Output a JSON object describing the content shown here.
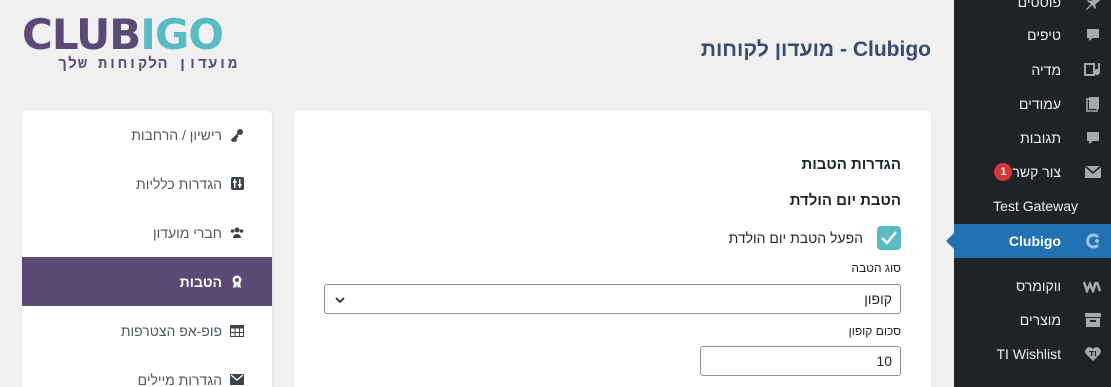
{
  "header": {
    "page_title": "Clubigo - מועדון לקוחות",
    "logo_part1": "CLUB",
    "logo_part2": "IGO",
    "logo_tagline": "מועדון הלקוחות שלך"
  },
  "wp_menu": {
    "items": [
      {
        "label": "פוסטים",
        "icon": "pin-icon"
      },
      {
        "label": "טיפים",
        "icon": "comment-icon"
      },
      {
        "label": "מדיה",
        "icon": "media-icon"
      },
      {
        "label": "עמודים",
        "icon": "pages-icon"
      },
      {
        "label": "תגובות",
        "icon": "comment-icon"
      },
      {
        "label": "צור קשר",
        "icon": "mail-icon",
        "badge": "1"
      },
      {
        "label": "Test Gateway"
      },
      {
        "label": "Clubigo",
        "icon": "clubigo-icon"
      },
      {
        "label": "ווקומרס",
        "icon": "woocommerce-icon"
      },
      {
        "label": "מוצרים",
        "icon": "archive-icon"
      },
      {
        "label": "TI Wishlist",
        "icon": "heart-icon"
      }
    ],
    "active_color": "#2271b1"
  },
  "settings_nav": {
    "items": [
      {
        "label": "רישיון / הרחבות",
        "icon": "key-icon"
      },
      {
        "label": "הגדרות כלליות",
        "icon": "settings-sliders-icon"
      },
      {
        "label": "חברי מועדון",
        "icon": "users-icon"
      },
      {
        "label": "הטבות",
        "icon": "award-icon",
        "active": true
      },
      {
        "label": "פופ-אפ הצטרפות",
        "icon": "table-icon"
      },
      {
        "label": "הגדרות מיילים",
        "icon": "mail-icon"
      }
    ],
    "active_color": "#5b4a76"
  },
  "main": {
    "section_title": "הגדרות הטבות",
    "subsection_title": "הטבת יום הולדת",
    "enable_checkbox": {
      "label": "הפעל הטבת יום הולדת",
      "checked": true
    },
    "benefit_type": {
      "label": "סוג הטבה",
      "value": "קופון"
    },
    "coupon_amount": {
      "label": "סכום קופון",
      "value": "10"
    },
    "accent_color": "#5bbbc4"
  }
}
